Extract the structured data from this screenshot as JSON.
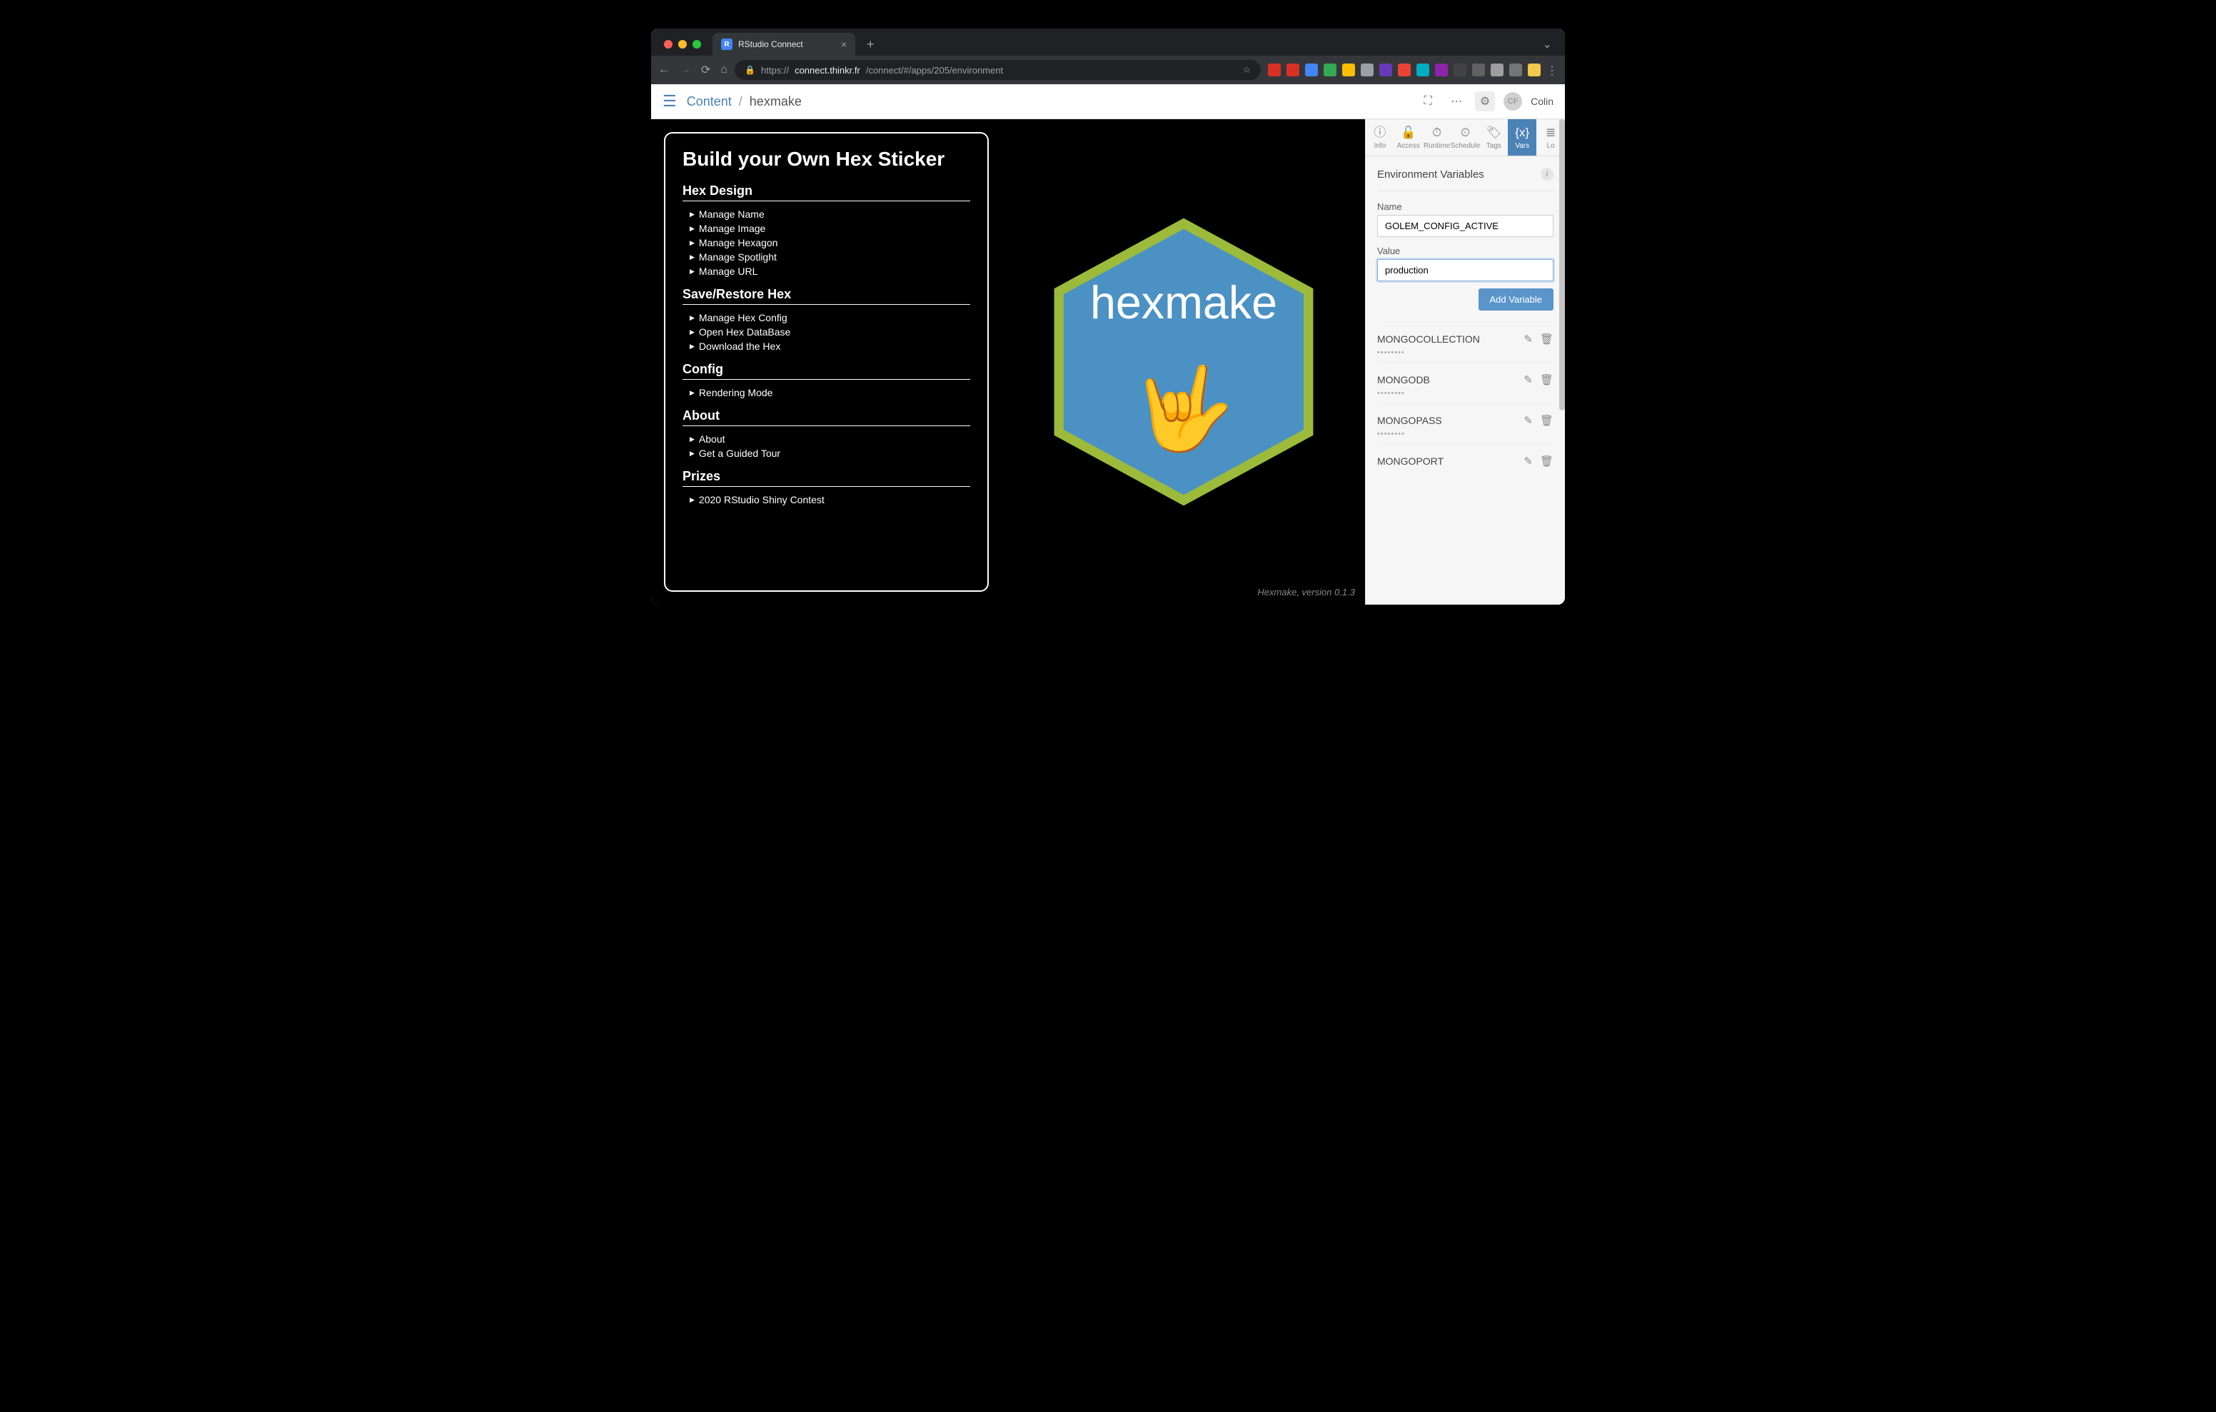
{
  "browser": {
    "tab_title": "RStudio Connect",
    "favicon_letter": "R",
    "url_prefix": "https://",
    "url_host": "connect.thinkr.fr",
    "url_path": "/connect/#/apps/205/environment"
  },
  "connect_header": {
    "content_link": "Content",
    "separator": "/",
    "page_title": "hexmake",
    "username": "Colin",
    "avatar_initials": "CF"
  },
  "app": {
    "title": "Build your Own Hex Sticker",
    "sections": [
      {
        "heading": "Hex Design",
        "items": [
          "Manage Name",
          "Manage Image",
          "Manage Hexagon",
          "Manage Spotlight",
          "Manage URL"
        ]
      },
      {
        "heading": "Save/Restore Hex",
        "items": [
          "Manage Hex Config",
          "Open Hex DataBase",
          "Download the Hex"
        ]
      },
      {
        "heading": "Config",
        "items": [
          "Rendering Mode"
        ]
      },
      {
        "heading": "About",
        "items": [
          "About",
          "Get a Guided Tour"
        ]
      },
      {
        "heading": "Prizes",
        "items": [
          "2020 RStudio Shiny Contest"
        ]
      }
    ],
    "hex_label": "hexmake",
    "hex_fill": "#4c91c3",
    "hex_border": "#9cbb3b",
    "hex_emoji": "🤟",
    "version": "Hexmake, version 0.1.3"
  },
  "settings": {
    "tabs": [
      {
        "label": "Info",
        "icon": "ⓘ"
      },
      {
        "label": "Access",
        "icon": "🔓"
      },
      {
        "label": "Runtime",
        "icon": "⏱"
      },
      {
        "label": "Schedule",
        "icon": "⏲"
      },
      {
        "label": "Tags",
        "icon": "🏷"
      },
      {
        "label": "Vars",
        "icon": "{x}"
      },
      {
        "label": "Lo",
        "icon": "≣"
      }
    ],
    "active_tab": "Vars",
    "section_title": "Environment Variables",
    "name_label": "Name",
    "name_value": "GOLEM_CONFIG_ACTIVE",
    "value_label": "Value",
    "value_value": "production",
    "add_button": "Add Variable",
    "existing": [
      {
        "name": "MONGOCOLLECTION",
        "value": "••••••••"
      },
      {
        "name": "MONGODB",
        "value": "••••••••"
      },
      {
        "name": "MONGOPASS",
        "value": "••••••••"
      },
      {
        "name": "MONGOPORT",
        "value": ""
      }
    ]
  }
}
